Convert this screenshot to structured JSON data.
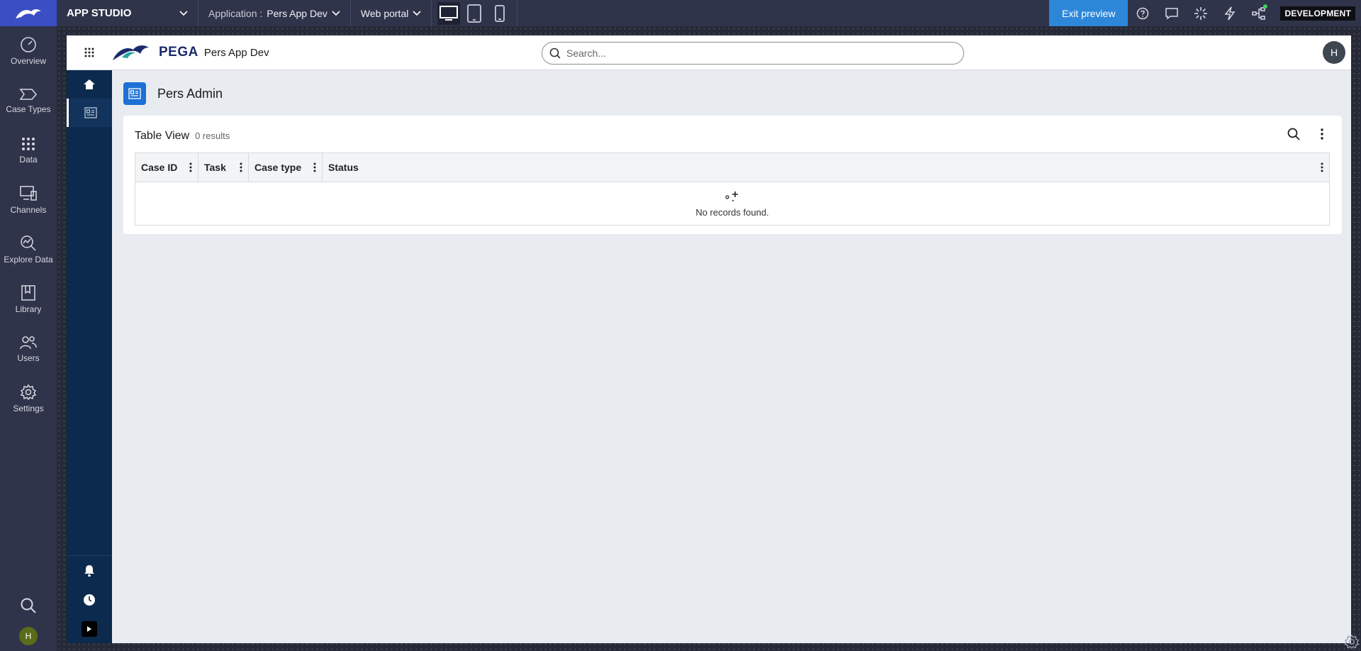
{
  "topbar": {
    "studio_label": "APP STUDIO",
    "application_prefix": "Application :",
    "application_value": "Pers App Dev",
    "portal_value": "Web portal",
    "exit_preview": "Exit preview",
    "environment": "DEVELOPMENT"
  },
  "leftnav": {
    "items": [
      {
        "label": "Overview",
        "icon": "gauge-icon"
      },
      {
        "label": "Case Types",
        "icon": "case-types-icon"
      },
      {
        "label": "Data",
        "icon": "data-grid-icon"
      },
      {
        "label": "Channels",
        "icon": "channels-icon"
      },
      {
        "label": "Explore Data",
        "icon": "explore-data-icon"
      },
      {
        "label": "Library",
        "icon": "library-icon"
      },
      {
        "label": "Users",
        "icon": "users-icon"
      },
      {
        "label": "Settings",
        "icon": "gear-icon"
      }
    ],
    "avatar_initial": "H"
  },
  "portal": {
    "logo_text": "PEGA",
    "app_name": "Pers App Dev",
    "search_placeholder": "Search...",
    "user_initial": "H",
    "page_title": "Pers Admin",
    "table": {
      "title": "Table View",
      "count": "0 results",
      "columns": [
        "Case ID",
        "Task",
        "Case type",
        "Status"
      ],
      "empty_message": "No records found."
    }
  },
  "colors": {
    "studio_bg": "#30344a",
    "brand_blue": "#3b4fc4",
    "exit_button": "#2d87d9",
    "portal_nav": "#0c2a4d",
    "page_icon": "#1d70d6"
  }
}
